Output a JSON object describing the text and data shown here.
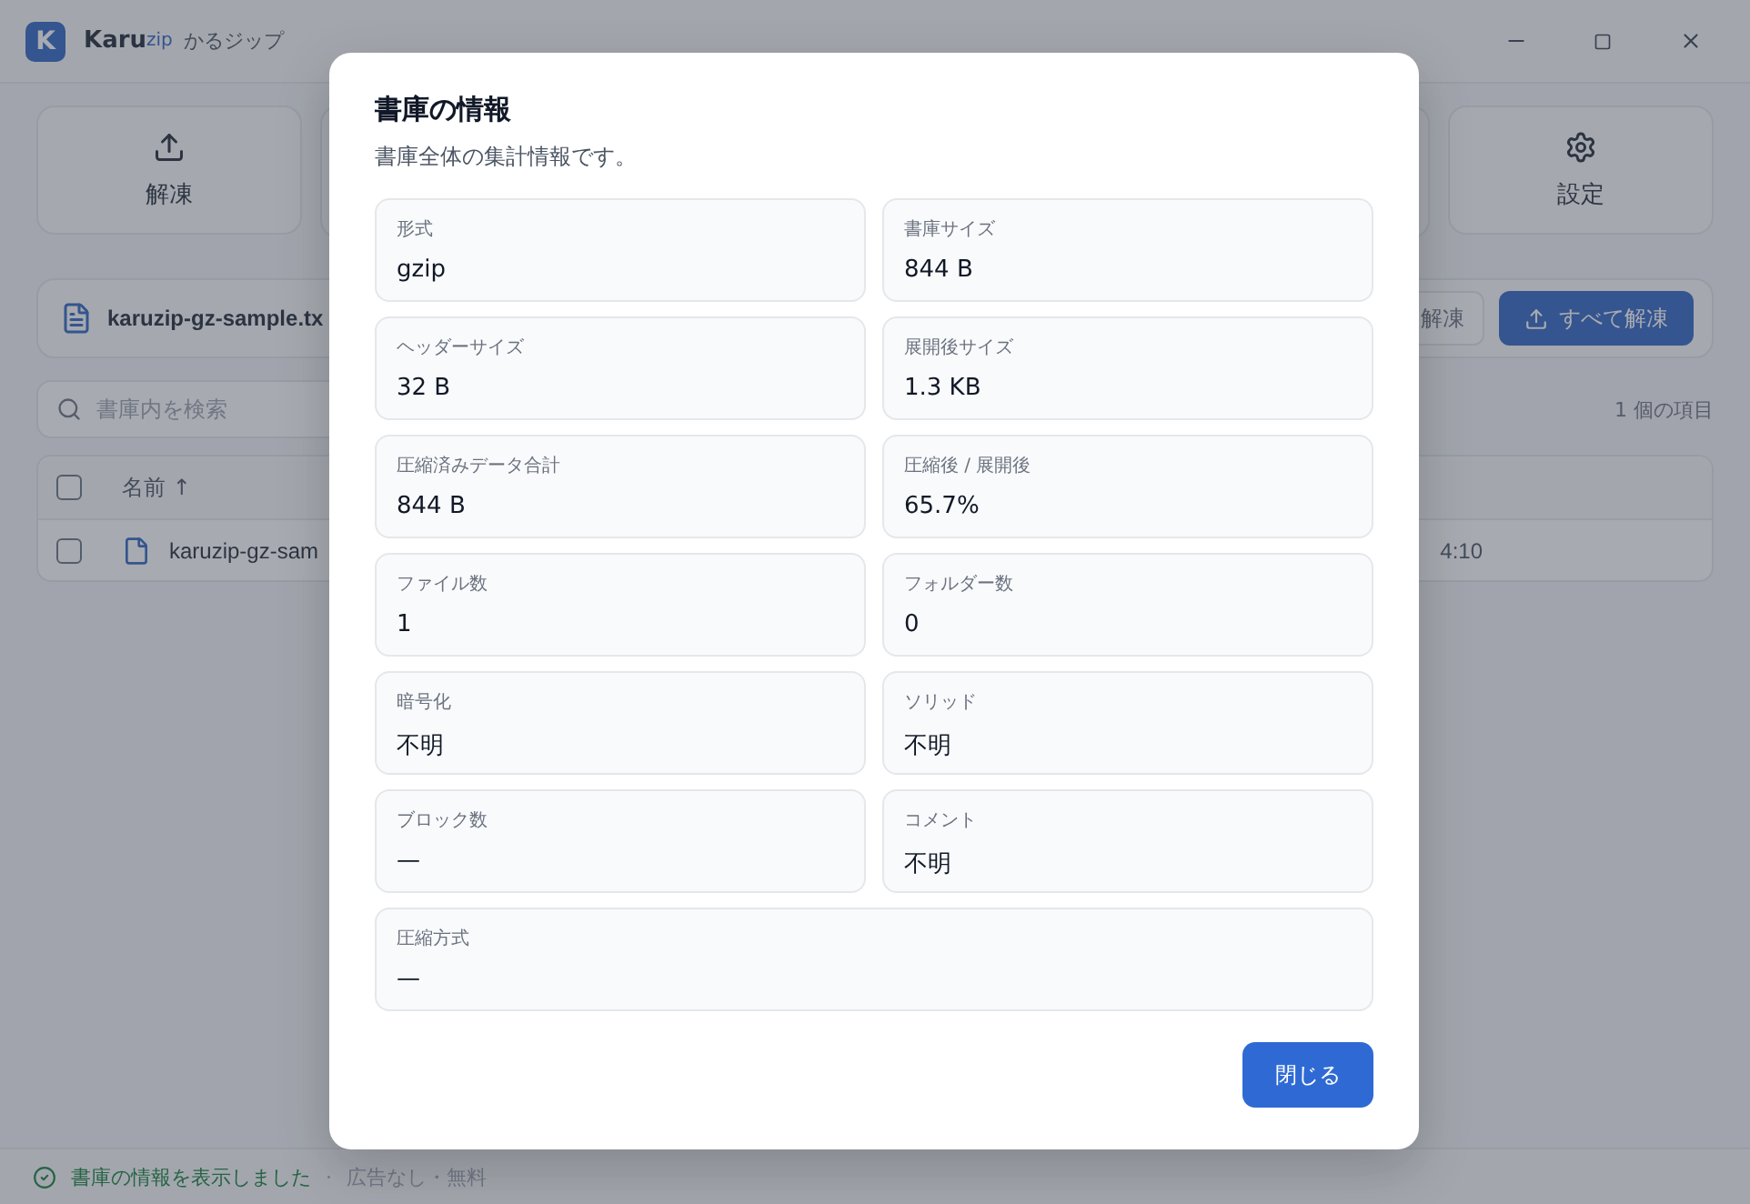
{
  "window": {
    "logo_letter": "K",
    "title_main": "Karu",
    "title_accent": "zip",
    "title_sub": "かるジップ"
  },
  "toolbar": {
    "left_button": "解凍",
    "right_button": "設定"
  },
  "file_bar": {
    "file_name": "karuzip-gz-sample.tx",
    "extract_button": "解凍",
    "extract_all_button": "すべて解凍"
  },
  "search": {
    "placeholder": "書庫内を検索",
    "item_count": "1 個の項目"
  },
  "table": {
    "header": {
      "name": "名前 ↑",
      "checked": false
    },
    "rows": [
      {
        "name": "karuzip-gz-sam",
        "time": "4:10",
        "checked": false
      }
    ]
  },
  "status_bar": {
    "message": "書庫の情報を表示しました",
    "separator": "·",
    "note": "広告なし・無料"
  },
  "dialog": {
    "title": "書庫の情報",
    "subtitle": "書庫全体の集計情報です。",
    "close_button": "閉じる",
    "fields": [
      {
        "label": "形式",
        "value": "gzip",
        "wide": false
      },
      {
        "label": "書庫サイズ",
        "value": "844 B",
        "wide": false
      },
      {
        "label": "ヘッダーサイズ",
        "value": "32 B",
        "wide": false
      },
      {
        "label": "展開後サイズ",
        "value": "1.3 KB",
        "wide": false
      },
      {
        "label": "圧縮済みデータ合計",
        "value": "844 B",
        "wide": false
      },
      {
        "label": "圧縮後 / 展開後",
        "value": "65.7%",
        "wide": false
      },
      {
        "label": "ファイル数",
        "value": "1",
        "wide": false
      },
      {
        "label": "フォルダー数",
        "value": "0",
        "wide": false
      },
      {
        "label": "暗号化",
        "value": "不明",
        "wide": false
      },
      {
        "label": "ソリッド",
        "value": "不明",
        "wide": false
      },
      {
        "label": "ブロック数",
        "value": "—",
        "wide": false
      },
      {
        "label": "コメント",
        "value": "不明",
        "wide": false
      },
      {
        "label": "圧縮方式",
        "value": "—",
        "wide": true
      }
    ]
  }
}
